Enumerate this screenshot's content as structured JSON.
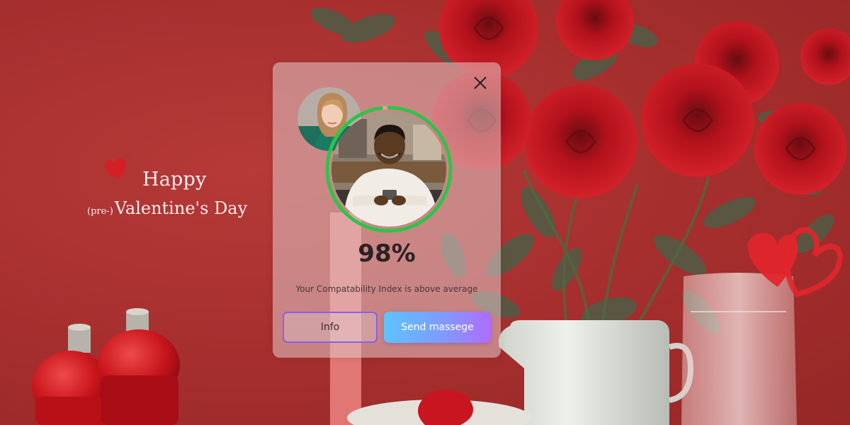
{
  "greeting": {
    "line1": "Happy",
    "prefix": "(pre-)",
    "line2": "Valentine's Day"
  },
  "card": {
    "close_icon": "close-icon",
    "compatibility_percent": 98,
    "percent_text": "98%",
    "caption": "Your Compatability Index is above average",
    "info_label": "Info",
    "send_label": "Send massege"
  },
  "colors": {
    "background": "#a8302f",
    "progress_ring": "#2fc24a",
    "send_gradient_start": "#5ec3ff",
    "send_gradient_end": "#b06cff",
    "info_border": "#8a5cf0"
  }
}
